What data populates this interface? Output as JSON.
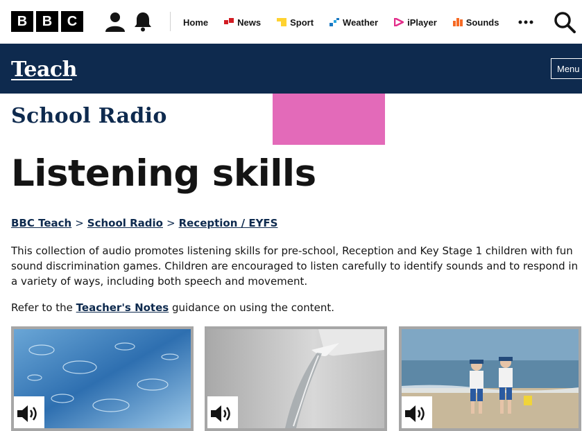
{
  "header": {
    "brand_letters": [
      "B",
      "B",
      "C"
    ],
    "nav": [
      {
        "label": "Home",
        "icon": "",
        "color": ""
      },
      {
        "label": "News",
        "icon": "news-icon",
        "color": "#d21c23"
      },
      {
        "label": "Sport",
        "icon": "sport-icon",
        "color": "#ffd230"
      },
      {
        "label": "Weather",
        "icon": "weather-icon",
        "color": "#1a78c2"
      },
      {
        "label": "iPlayer",
        "icon": "iplayer-icon",
        "color": "#e32d8a"
      },
      {
        "label": "Sounds",
        "icon": "sounds-icon",
        "color": "#f66a24"
      }
    ]
  },
  "teach": {
    "logo": "Teach",
    "menu_label": "Menu"
  },
  "banner": {
    "section": "School Radio",
    "accent": "#e36ab9"
  },
  "page": {
    "title": "Listening skills",
    "breadcrumbs": [
      "BBC Teach",
      "School Radio",
      "Reception / EYFS"
    ],
    "breadcrumb_sep": ">",
    "intro": "This collection of audio promotes listening skills for pre-school, Reception and Key Stage 1 children with fun sound discrimination games. Children are encouraged to listen carefully to identify sounds and to respond in a variety of ways, including both speech and movement.",
    "refer_prefix": "Refer to the",
    "refer_link": "Teacher's Notes",
    "refer_suffix": "guidance on using the content."
  },
  "cards": [
    {
      "image": "rain-on-water",
      "icon": "speaker-icon"
    },
    {
      "image": "water-from-tap",
      "icon": "speaker-icon"
    },
    {
      "image": "children-at-beach",
      "icon": "speaker-icon"
    }
  ],
  "colors": {
    "navy": "#0e2a4e",
    "pink": "#e36ab9"
  }
}
